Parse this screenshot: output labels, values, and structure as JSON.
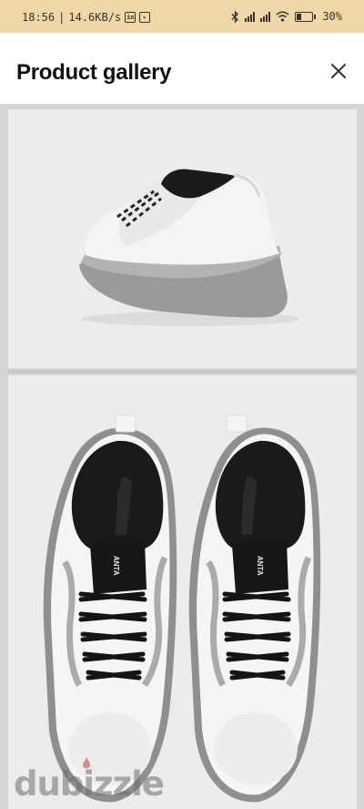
{
  "status_bar": {
    "time": "18:56",
    "network_speed": "14.6KB/s",
    "app_icons": [
      "linkedin-icon",
      "media-icon"
    ],
    "battery_percent": "30%",
    "icons": [
      "bluetooth-icon",
      "signal-icon",
      "signal-icon",
      "wifi-icon",
      "battery-icon"
    ]
  },
  "header": {
    "title": "Product gallery",
    "close_icon": "close-icon"
  },
  "gallery": {
    "images": [
      {
        "name": "sneaker-side-rear-view"
      },
      {
        "name": "sneaker-pair-top-view",
        "brand_text": "ANTA"
      }
    ]
  },
  "watermark": {
    "text": "dubizzle"
  },
  "colors": {
    "status_bar_bg": "#f0d7a8",
    "header_bg": "#ffffff",
    "gallery_bg": "#d6d6d6"
  }
}
